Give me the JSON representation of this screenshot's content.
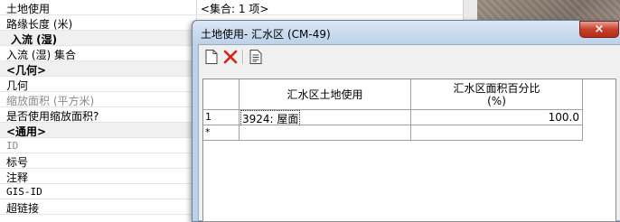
{
  "property_grid": {
    "value_text": "<集合: 1 项>",
    "rows": [
      {
        "label": "土地使用"
      },
      {
        "label": "路缘长度 (米)"
      },
      {
        "label": "入流 (湿)"
      },
      {
        "label": "入流 (湿) 集合"
      },
      {
        "label": "<几何>"
      },
      {
        "label": "几何"
      },
      {
        "label": "缩放面积 (平方米)"
      },
      {
        "label": "是否使用缩放面积?"
      },
      {
        "label": "<通用>"
      },
      {
        "label": "ID"
      },
      {
        "label": "标号"
      },
      {
        "label": "注释"
      },
      {
        "label": "GIS-ID"
      },
      {
        "label": "超链接"
      }
    ]
  },
  "dialog": {
    "title": "土地使用- 汇水区 (CM-49)",
    "close_glyph": "x",
    "toolbar": {
      "new_icon": "new-document-icon",
      "delete_icon": "delete-x-icon",
      "report_icon": "report-icon"
    },
    "table": {
      "headers": {
        "col1": "汇水区土地使用",
        "col2_line1": "汇水区面积百分比",
        "col2_line2": "(%)"
      },
      "rows": [
        {
          "row_header": "1",
          "land_use": "3924: 屋面",
          "percent": "100.0"
        },
        {
          "row_header": "*",
          "land_use": "",
          "percent": ""
        }
      ]
    }
  },
  "colors": {
    "titlebar": "#bcd1ea",
    "close_button": "#c7402c",
    "category_row": "#f0f0f0"
  }
}
